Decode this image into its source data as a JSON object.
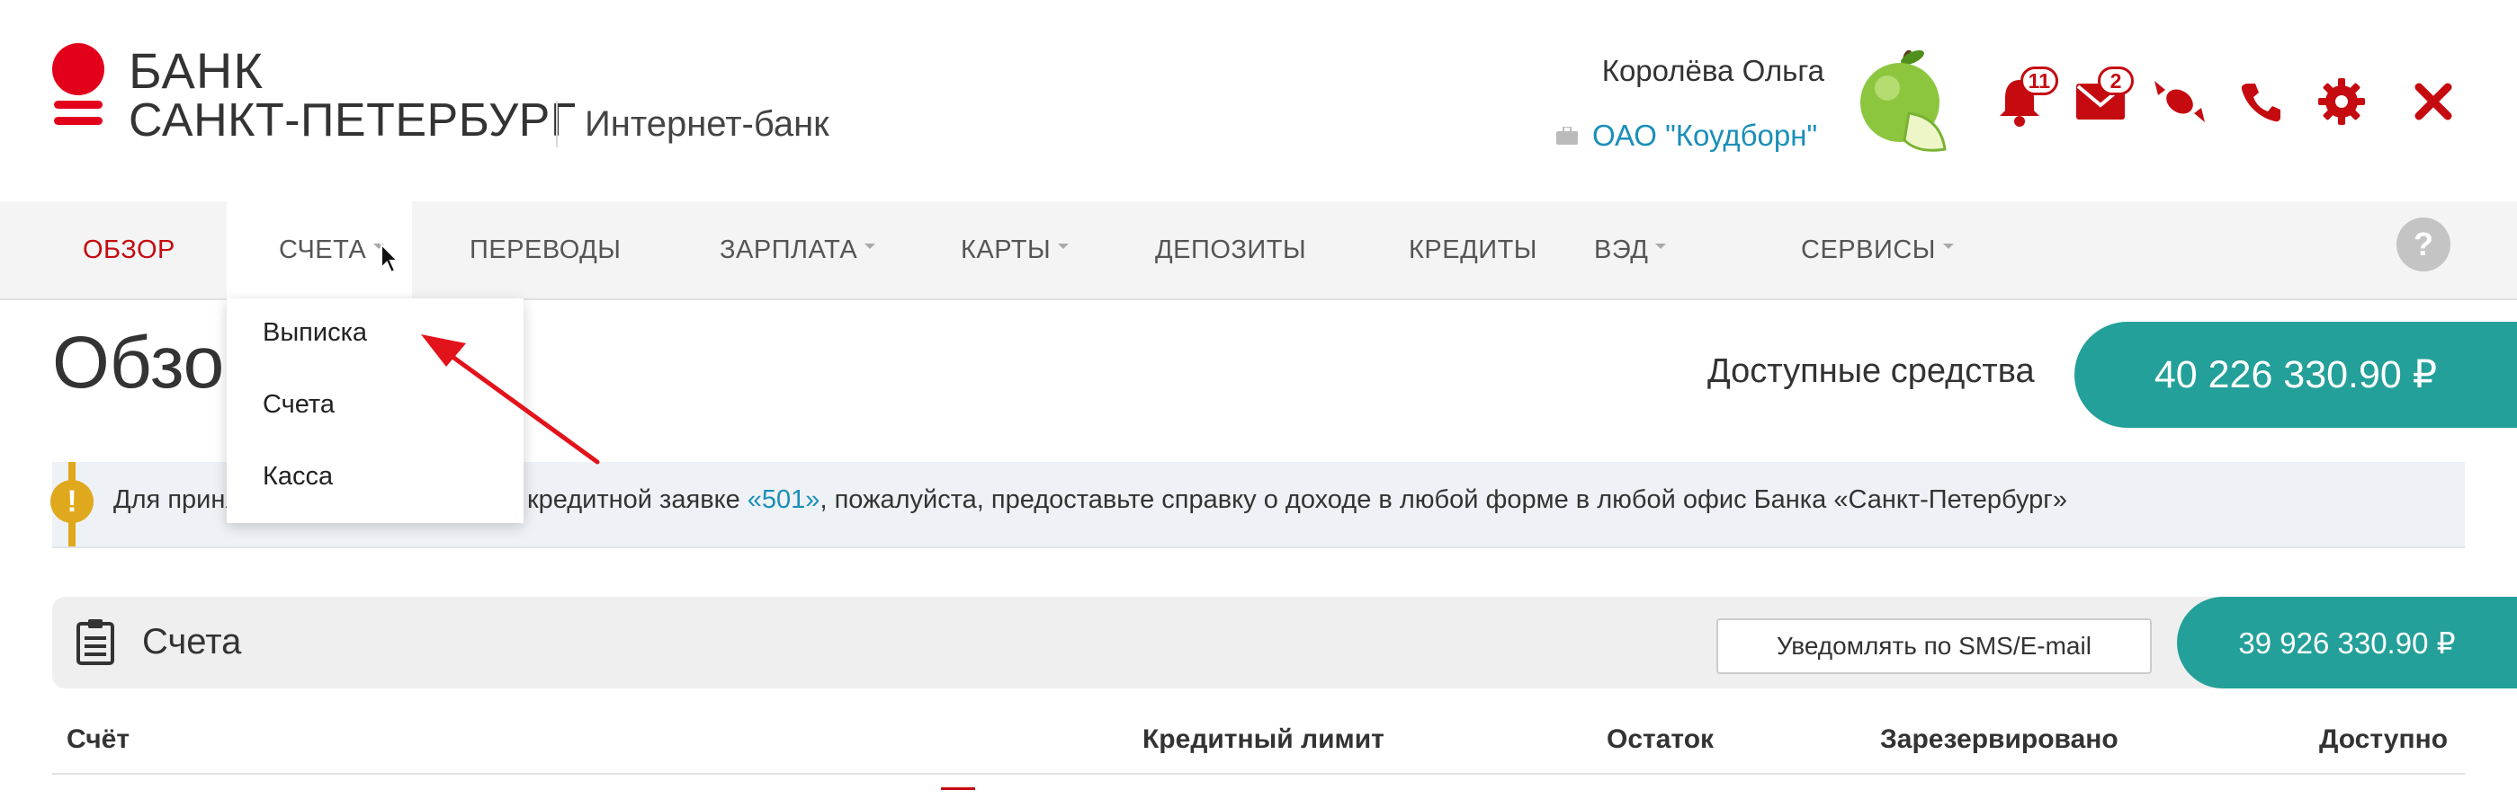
{
  "header": {
    "brand_line1": "БАНК",
    "brand_line2": "САНКТ-ПЕТЕРБУРГ",
    "brand_sub": "Интернет-банк",
    "user_name": "Королёва Ольга",
    "company": "ОАО \"Коудборн\"",
    "notifications_count": "11",
    "messages_count": "2",
    "icons": [
      "bell-icon",
      "envelope-icon",
      "candy-icon",
      "phone-icon",
      "gear-icon",
      "close-icon"
    ]
  },
  "nav": {
    "items": [
      {
        "label": "ОБЗОР",
        "active": true
      },
      {
        "label": "СЧЕТА",
        "dropdown": true,
        "open": true
      },
      {
        "label": "ПЕРЕВОДЫ"
      },
      {
        "label": "ЗАРПЛАТА",
        "dropdown": true
      },
      {
        "label": "КАРТЫ",
        "dropdown": true
      },
      {
        "label": "ДЕПОЗИТЫ"
      },
      {
        "label": "КРЕДИТЫ"
      },
      {
        "label": "ВЭД",
        "dropdown": true
      },
      {
        "label": "СЕРВИСЫ",
        "dropdown": true
      }
    ],
    "help": "?"
  },
  "dropdown": {
    "items": [
      "Выписка",
      "Счета",
      "Касса"
    ]
  },
  "overview": {
    "title": "Обзор",
    "available_label": "Доступные средства",
    "available_amount": "40 226 330.90 ₽"
  },
  "alert": {
    "text_before": "Для принятия решения по Вашей кредитной заявке ",
    "link": "«501»",
    "text_after": ", пожалуйста, предоставьте справку о доходе в любой форме в любой офис Банка «Санкт-Петербург»"
  },
  "accounts": {
    "title": "Счета",
    "notify_button": "Уведомлять по SMS/E-mail",
    "amount": "39 926 330.90 ₽",
    "columns": [
      "Счёт",
      "Кредитный лимит",
      "Остаток",
      "Зарезервировано",
      "Доступно"
    ]
  },
  "colors": {
    "brand_red": "#c50a10",
    "teal": "#24a09a",
    "link_blue": "#1a8fb8",
    "warning": "#e0a81c"
  }
}
